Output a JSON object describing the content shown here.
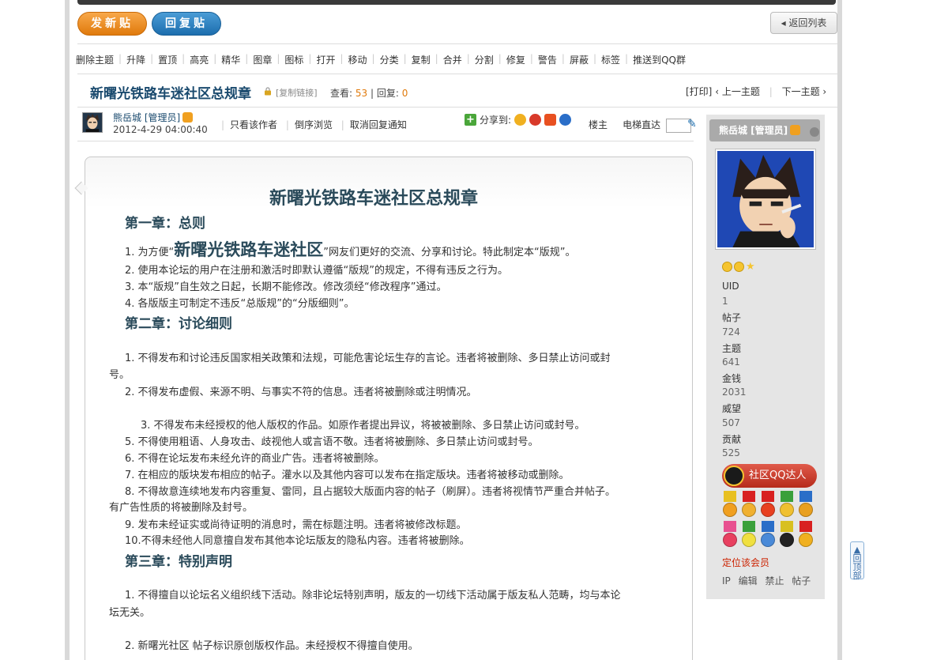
{
  "toolbar": {
    "new_post": "发新贴",
    "reply_post": "回复贴",
    "back_to_list": "返回列表"
  },
  "mod_actions": [
    "删除主题",
    "升降",
    "置顶",
    "高亮",
    "精华",
    "图章",
    "图标",
    "打开",
    "移动",
    "分类",
    "复制",
    "合并",
    "分割",
    "修复",
    "警告",
    "屏蔽",
    "标签",
    "推送到QQ群"
  ],
  "thread": {
    "title": "新曙光铁路车迷社区总规章",
    "copy_link": "[复制链接]",
    "views_label": "查看:",
    "views": "53",
    "sep": "|",
    "replies_label": "回复:",
    "replies": "0",
    "print": "[打印]",
    "prev_topic": "上一主题",
    "next_topic": "下一主题"
  },
  "post": {
    "author": "熊岳城 [管理员]",
    "time": "2012-4-29 04:00:40",
    "only_author": "只看该作者",
    "reverse": "倒序浏览",
    "cancel_notify": "取消回复通知",
    "share_label": "分享到:",
    "floor_label": "楼主",
    "elevator_label": "电梯直达"
  },
  "content": {
    "heading": "新曙光铁路车迷社区总规章",
    "ch1": "第一章：总则",
    "r1_pre": "1. 为方便“",
    "r1_big": "新曙光铁路车迷社区",
    "r1_post": "”网友们更好的交流、分享和讨论。特此制定本“版规”。",
    "r2": "2. 使用本论坛的用户在注册和激活时即默认遵循“版规”的规定，不得有违反之行为。",
    "r3": "3. 本“版规”自生效之日起，长期不能修改。修改须经“修改程序”通过。",
    "r4": "4. 各版版主可制定不违反“总版规”的“分版细则”。",
    "ch2": "第二章：讨论细则",
    "d1a": "1. 不得发布和讨论违反国家相关政策和法规，可能危害论坛生存的言论。违者将被删除、多日禁止访问或封",
    "d1b": "号。",
    "d2": "2. 不得发布虚假、来源不明、与事实不符的信息。违者将被删除或注明情况。",
    "d3": "3. 不得发布未经授权的他人版权的作品。如原作者提出异议，将被被删除、多日禁止访问或封号。",
    "d5": "5. 不得使用粗语、人身攻击、歧视他人或言语不敬。违者将被删除、多日禁止访问或封号。",
    "d6": "6. 不得在论坛发布未经允许的商业广告。违者将被删除。",
    "d7": "7. 在相应的版块发布相应的帖子。灌水以及其他内容可以发布在指定版块。违者将被移动或删除。",
    "d8a": "8. 不得故意连续地发布内容重复、雷同，且占据较大版面内容的帖子（刷屏）。违者将视情节严重合并帖子。",
    "d8b": "有广告性质的将被删除及封号。",
    "d9": "9. 发布未经证实或尚待证明的消息时，需在标题注明。违者将被修改标题。",
    "d10": "10.不得未经他人同意擅自发布其他本论坛版友的隐私内容。违者将被删除。",
    "ch3": "第三章：特别声明",
    "s1a": "1. 不得擅自以论坛名义组织线下活动。除非论坛特别声明，版友的一切线下活动属于版友私人范畴，均与本论",
    "s1b": "坛无关。",
    "s2": "2. 新曙光社区 帖子标识原创版权作品。未经授权不得擅自使用。"
  },
  "sidebar": {
    "name": "熊岳城 [管理员]",
    "uid_label": "UID",
    "uid": "1",
    "posts_label": "帖子",
    "posts": "724",
    "threads_label": "主题",
    "threads": "641",
    "money_label": "金钱",
    "money": "2031",
    "prestige_label": "威望",
    "prestige": "507",
    "contrib_label": "贡献",
    "contrib": "525",
    "qq_badge": "社区QQ达人",
    "locate": "定位该会员",
    "ip": "IP",
    "edit": "编辑",
    "ban": "禁止",
    "posts_link": "帖子"
  },
  "back_to_top": "回顶部",
  "colors": {
    "orange": "#e07a0c",
    "blue": "#1d6eae",
    "title": "#1a4a6e",
    "red": "#cc2200"
  }
}
